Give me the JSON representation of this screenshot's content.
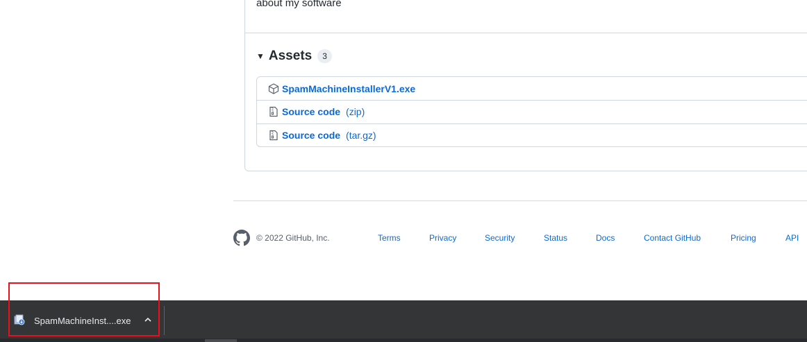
{
  "release": {
    "body_text": "about my software"
  },
  "assets": {
    "title": "Assets",
    "count": "3",
    "items": [
      {
        "name": "SpamMachineInstallerV1.exe",
        "ext": "",
        "icon": "package-icon"
      },
      {
        "name": "Source code",
        "ext": "(zip)",
        "icon": "file-zip-icon"
      },
      {
        "name": "Source code",
        "ext": "(tar.gz)",
        "icon": "file-zip-icon"
      }
    ]
  },
  "footer": {
    "copyright": "© 2022 GitHub, Inc.",
    "links": [
      "Terms",
      "Privacy",
      "Security",
      "Status",
      "Docs",
      "Contact GitHub",
      "Pricing",
      "API"
    ]
  },
  "download_bar": {
    "file_name": "SpamMachineInst....exe",
    "icon": "installer-file-icon"
  },
  "colors": {
    "link": "#0969da",
    "border": "#d0d7de",
    "download_bar_bg": "#333537",
    "highlight": "#e8101a"
  }
}
